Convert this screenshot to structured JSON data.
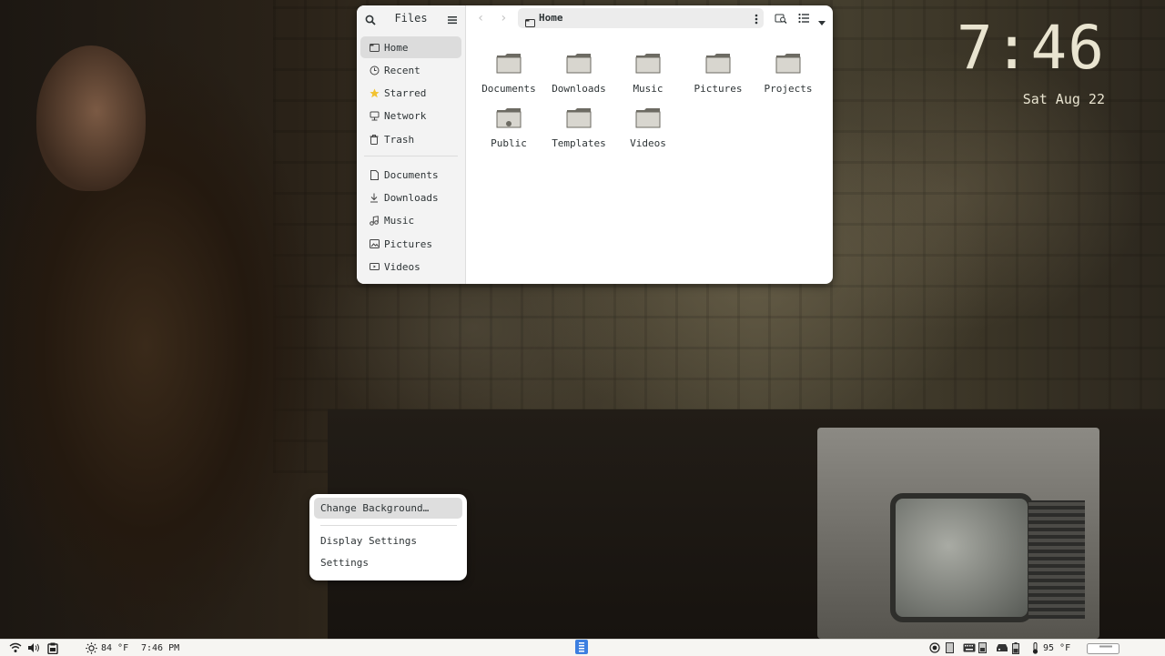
{
  "desktop": {
    "clock_time": "7:46",
    "clock_date": "Sat Aug 22"
  },
  "files": {
    "title": "Files",
    "path": "Home",
    "sidebar": {
      "places": [
        {
          "label": "Home",
          "icon": "home-icon",
          "active": true
        },
        {
          "label": "Recent",
          "icon": "recent-icon"
        },
        {
          "label": "Starred",
          "icon": "star-icon"
        },
        {
          "label": "Network",
          "icon": "network-icon"
        },
        {
          "label": "Trash",
          "icon": "trash-icon"
        }
      ],
      "bookmarks": [
        {
          "label": "Documents",
          "icon": "document-icon"
        },
        {
          "label": "Downloads",
          "icon": "download-icon"
        },
        {
          "label": "Music",
          "icon": "music-icon"
        },
        {
          "label": "Pictures",
          "icon": "picture-icon"
        },
        {
          "label": "Videos",
          "icon": "video-icon"
        }
      ]
    },
    "folders": [
      "Documents",
      "Downloads",
      "Music",
      "Pictures",
      "Projects",
      "Public",
      "Templates",
      "Videos"
    ]
  },
  "context_menu": {
    "items": [
      "Change Background…",
      "Display Settings",
      "Settings"
    ]
  },
  "panel": {
    "weather_left": "84 °F",
    "time": "7:46 PM",
    "temp_right": "95 °F"
  },
  "colors": {
    "clock": "#e9e4d0",
    "active_workspace": "#3d7fe0",
    "highlight": "#dedede"
  }
}
